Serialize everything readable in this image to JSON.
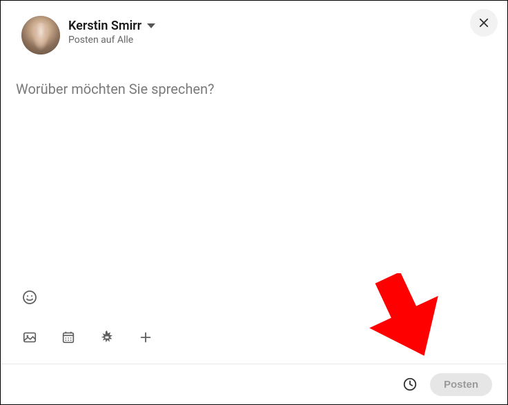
{
  "user": {
    "name": "Kerstin Smirr",
    "visibility_label": "Posten auf Alle"
  },
  "compose": {
    "placeholder": "Worüber möchten Sie sprechen?",
    "value": ""
  },
  "footer": {
    "post_button_label": "Posten"
  },
  "icons": {
    "close": "close-icon",
    "dropdown": "chevron-down-icon",
    "emoji": "emoji-icon",
    "image": "image-icon",
    "calendar": "calendar-icon",
    "starburst": "starburst-icon",
    "plus": "plus-icon",
    "clock": "clock-icon"
  },
  "colors": {
    "text_primary": "#191919",
    "text_secondary": "#666666",
    "placeholder": "#7a7a7a",
    "disabled_bg": "#e6e6e6",
    "disabled_fg": "#9a9a9a",
    "annotation_arrow": "#ff0000"
  }
}
